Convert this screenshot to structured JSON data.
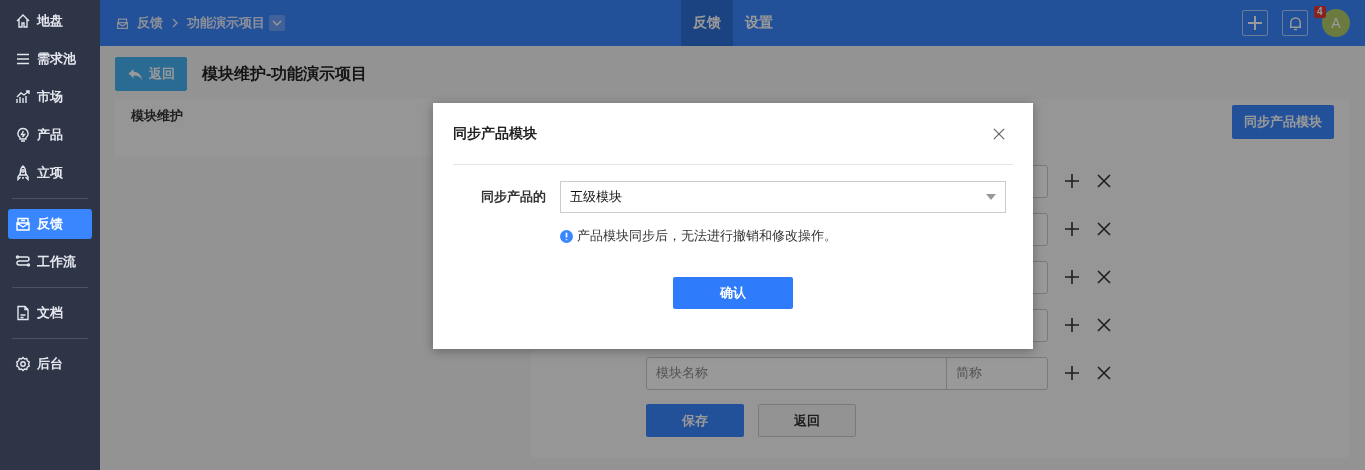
{
  "sidebar": {
    "groups": [
      {
        "items": [
          {
            "label": "地盘",
            "selected": false
          },
          {
            "label": "需求池",
            "selected": false
          },
          {
            "label": "市场",
            "selected": false
          },
          {
            "label": "产品",
            "selected": false
          },
          {
            "label": "立项",
            "selected": false
          }
        ]
      },
      {
        "items": [
          {
            "label": "反馈",
            "selected": true
          },
          {
            "label": "工作流",
            "selected": false
          }
        ]
      },
      {
        "items": [
          {
            "label": "文档",
            "selected": false
          }
        ]
      },
      {
        "items": [
          {
            "label": "后台",
            "selected": false
          }
        ]
      }
    ]
  },
  "header": {
    "breadcrumb": [
      "反馈",
      "功能演示项目"
    ],
    "tabs": [
      {
        "label": "反馈",
        "selected": true
      },
      {
        "label": "设置",
        "selected": false
      }
    ],
    "notification_count": "4",
    "avatar": "A"
  },
  "page": {
    "back_button": "返回",
    "title": "模块维护-功能演示项目",
    "section_tab": "模块维护",
    "sync_button": "同步产品模块",
    "rows": [
      {
        "kind": "covered"
      },
      {
        "kind": "covered"
      },
      {
        "kind": "covered"
      },
      {
        "kind": "covered"
      },
      {
        "kind": "visible",
        "name_placeholder": "模块名称",
        "abbr_placeholder": "简称"
      }
    ],
    "save_button": "保存",
    "return_button": "返回"
  },
  "dialog": {
    "title": "同步产品模块",
    "label": "同步产品的",
    "value": "五级模块",
    "notice": "产品模块同步后，无法进行撤销和修改操作。",
    "confirm_button": "确认"
  }
}
